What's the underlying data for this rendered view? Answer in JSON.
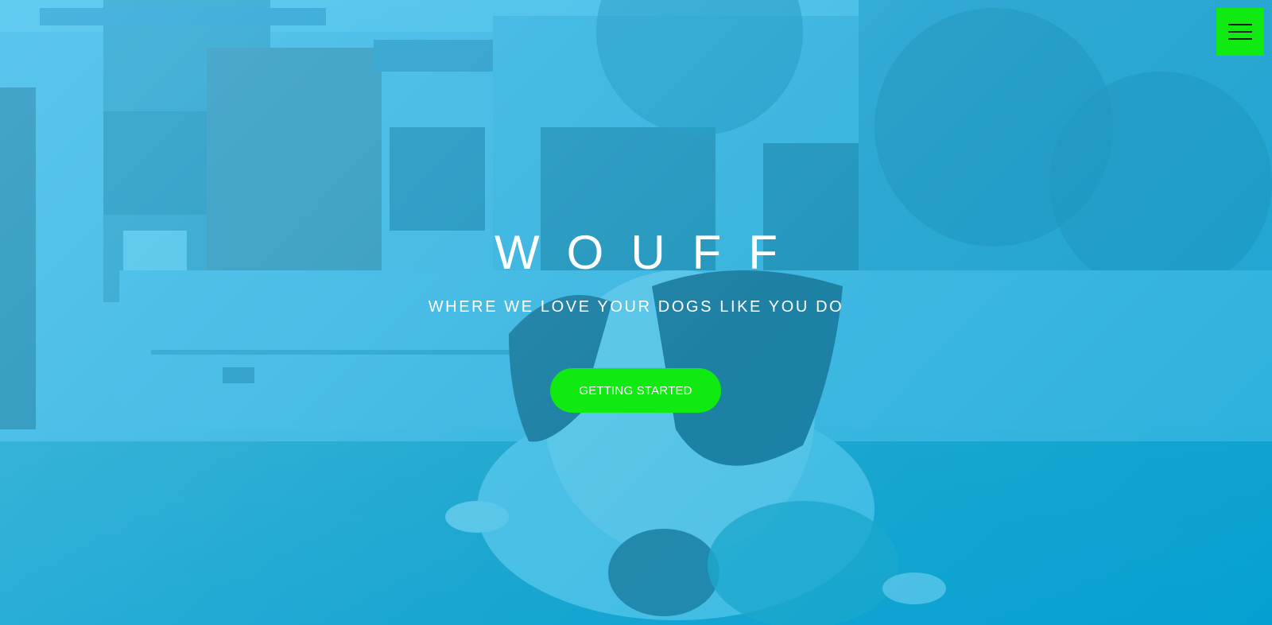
{
  "header": {
    "menu_icon": "hamburger-menu-icon",
    "menu_color": "#10ea10"
  },
  "hero": {
    "title": "WOUFF",
    "tagline": "WHERE WE LOVE YOUR DOGS LIKE YOU DO",
    "cta_label": "GETTING STARTED",
    "accent_color": "#10ea10",
    "overlay_color": "#1fa8dc"
  }
}
